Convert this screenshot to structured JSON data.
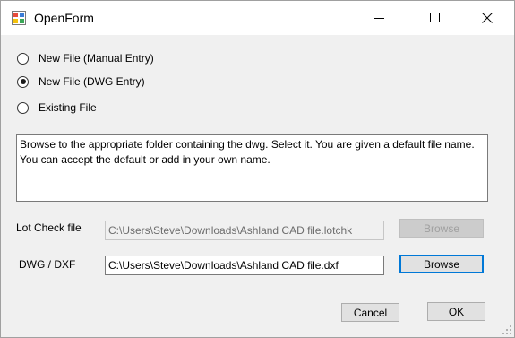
{
  "window": {
    "title": "OpenForm",
    "icon": "form-app-icon",
    "controls": [
      "minimize-icon",
      "maximize-icon",
      "close-icon"
    ]
  },
  "options": {
    "manual": {
      "label": "New File (Manual Entry)",
      "checked": false
    },
    "dwg": {
      "label": "New File (DWG Entry)",
      "checked": true
    },
    "existing": {
      "label": "Existing File",
      "checked": false
    }
  },
  "description": "Browse to the appropriate folder containing the dwg. Select it. You are given a default file name. You can accept the default or add in your own name.",
  "lot_check": {
    "label": "Lot Check file",
    "value": "C:\\Users\\Steve\\Downloads\\Ashland CAD file.lotchk",
    "browse_label": "Browse",
    "enabled": false
  },
  "dwg_dxf": {
    "label": "DWG / DXF",
    "value": "C:\\Users\\Steve\\Downloads\\Ashland CAD file.dxf",
    "browse_label": "Browse",
    "enabled": true
  },
  "buttons": {
    "cancel": "Cancel",
    "ok": "OK"
  },
  "colors": {
    "accent": "#0078d7",
    "window_bg": "#f0f0f0"
  }
}
